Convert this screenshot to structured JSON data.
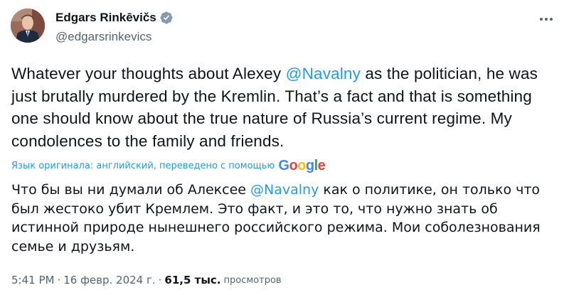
{
  "author": {
    "display_name": "Edgars Rinkēvičs",
    "handle": "@edgarsrinkevics",
    "verified": true
  },
  "tweet": {
    "text_before_mention": "Whatever your thoughts about Alexey ",
    "mention": "@Navalny",
    "text_after_mention": " as the politician, he was just brutally murdered by the Kremlin. That’s a fact and that is something one should know about the true nature of Russia’s current regime. My condolences to the family and friends."
  },
  "translation": {
    "label": "Язык оригинала: английский, переведено с помощью",
    "provider": "Google",
    "text_before_mention": "Что бы вы ни думали об Алексее ",
    "mention": "@Navalny",
    "text_after_mention": " как о политике, он только что был жестоко убит Кремлем. Это факт, и это то, что нужно знать об истинной природе нынешнего российского режима. Мои соболезнования семье и друзьям."
  },
  "meta": {
    "time": "5:41 PM",
    "separator": "·",
    "date": "16 февр. 2024 г.",
    "views_count": "61,5 тыс.",
    "views_label": "просмотров"
  },
  "colors": {
    "accent": "#1d9bf0",
    "text": "#0f1419",
    "secondary": "#536471",
    "verified_badge": "#829aab"
  },
  "icons": {
    "verified": "verified-badge-icon",
    "more": "more-options-icon"
  }
}
